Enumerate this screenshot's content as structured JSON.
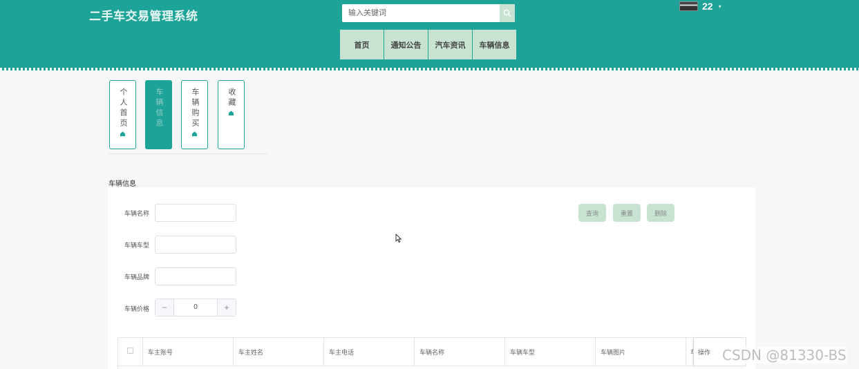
{
  "app": {
    "title": "二手车交易管理系统"
  },
  "search": {
    "placeholder": "输入关键词",
    "icon": "search-icon"
  },
  "user": {
    "name": "22"
  },
  "nav": {
    "items": [
      "首页",
      "通知公告",
      "汽车资讯",
      "车辆信息"
    ]
  },
  "side_tabs": [
    {
      "label": "个人首页",
      "active": false
    },
    {
      "label": "车辆信息",
      "active": true
    },
    {
      "label": "车辆购买",
      "active": false
    },
    {
      "label": "收藏",
      "active": false
    }
  ],
  "section": {
    "title": "车辆信息"
  },
  "filters": {
    "name_label": "车辆名称",
    "name_value": "",
    "model_label": "车辆车型",
    "model_value": "",
    "brand_label": "车辆品牌",
    "brand_value": "",
    "price_label": "车辆价格",
    "price_value": "0",
    "minus": "−",
    "plus": "+"
  },
  "actions": {
    "query": "查询",
    "reset": "重置",
    "delete": "删除"
  },
  "table": {
    "columns": [
      "车主账号",
      "车主姓名",
      "车主电话",
      "车辆名称",
      "车辆车型",
      "车辆图片",
      "车",
      "操作"
    ]
  },
  "watermark": "CSDN @81330-BS",
  "colors": {
    "primary": "#1ea398",
    "light": "#c9e3d2"
  }
}
